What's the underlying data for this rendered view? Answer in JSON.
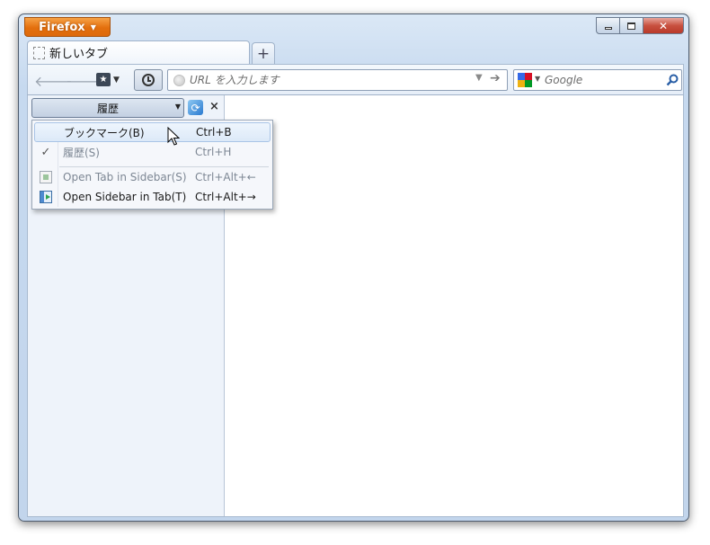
{
  "window": {
    "app_button_label": "Firefox",
    "close_glyph": "✕"
  },
  "tab": {
    "title": "新しいタブ",
    "new_tab_glyph": "+"
  },
  "toolbar": {
    "back_glyph": "🡐",
    "forward_glyph": "🡒",
    "url_placeholder": "URL を入力します",
    "search_placeholder": "Google"
  },
  "sidebar": {
    "switcher_label": "履歴",
    "close_glyph": "×"
  },
  "menu": {
    "items": [
      {
        "label": "ブックマーク(B)",
        "accel": "Ctrl+B",
        "checked": false,
        "disabled": false,
        "icon": ""
      },
      {
        "label": "履歴(S)",
        "accel": "Ctrl+H",
        "checked": true,
        "disabled": true,
        "icon": ""
      },
      {
        "label": "Open Tab in Sidebar(S)",
        "accel": "Ctrl+Alt+←",
        "checked": false,
        "disabled": true,
        "icon": "tab-in-sidebar-icon"
      },
      {
        "label": "Open Sidebar in Tab(T)",
        "accel": "Ctrl+Alt+→",
        "checked": false,
        "disabled": false,
        "icon": "sidebar-in-tab-icon"
      }
    ]
  },
  "colors": {
    "app_button": "#e36f0d",
    "close_button": "#c8503f",
    "menu_highlight": "#dce9f8"
  }
}
